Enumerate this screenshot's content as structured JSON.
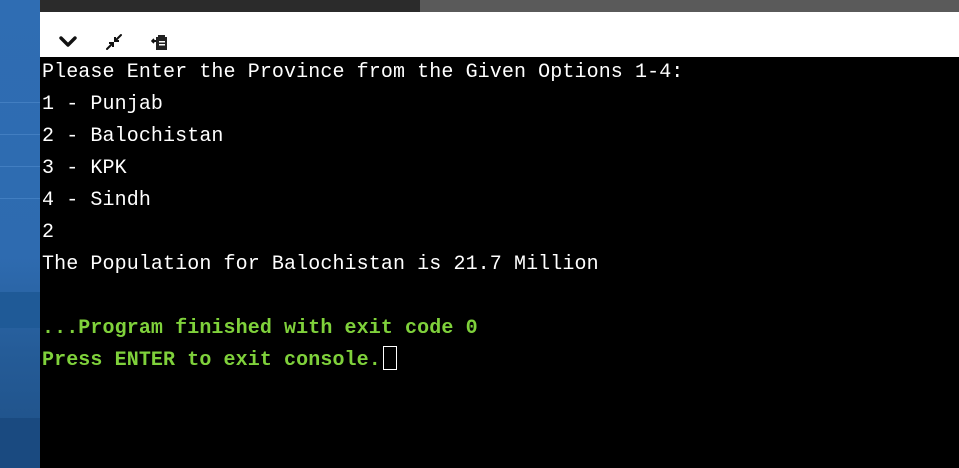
{
  "toolbar": {
    "icons": [
      "chevron-down-icon",
      "collapse-arrows-icon",
      "clipboard-icon"
    ]
  },
  "console": {
    "lines": [
      "Please Enter the Province from the Given Options 1-4:",
      "1 - Punjab",
      "2 - Balochistan",
      "3 - KPK",
      "4 - Sindh",
      "2",
      "The Population for Balochistan is 21.7 Million",
      "",
      "...Program finished with exit code 0",
      "Press ENTER to exit console."
    ]
  },
  "colors": {
    "console_bg": "#000000",
    "console_text": "#ffffff",
    "status_text": "#7fd13b",
    "stripe": "#2f6db3"
  }
}
